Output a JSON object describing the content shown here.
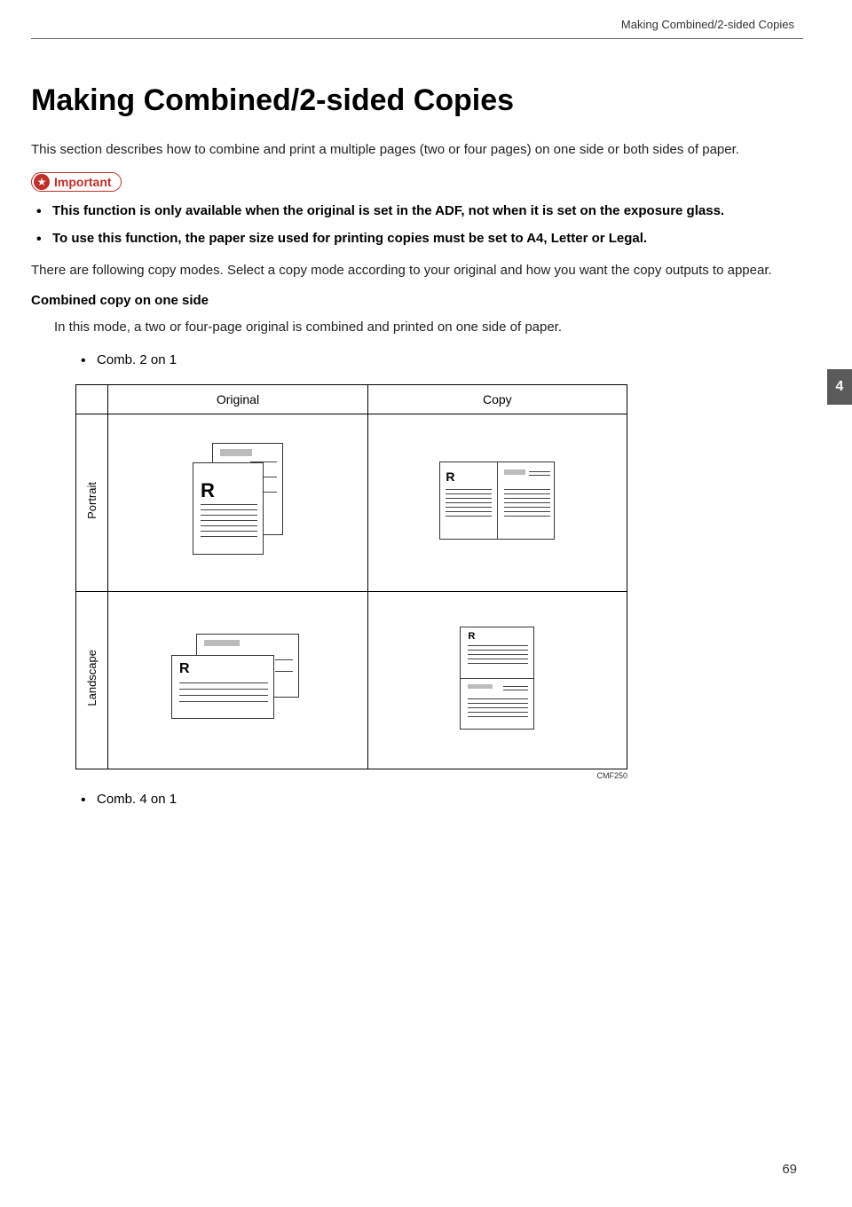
{
  "running_header": "Making Combined/2-sided Copies",
  "page_title": "Making Combined/2-sided Copies",
  "intro": "This section describes how to combine and print a multiple pages (two or four pages) on one side or both sides of paper.",
  "important_label": "Important",
  "important_bullets": [
    "This function is only available when the original is set in the ADF, not when it is set on the exposure glass.",
    "To use this function, the paper size used for printing copies must be set to A4, Letter or Legal."
  ],
  "modes_intro": "There are following copy modes. Select a copy mode according to your original and how you want the copy outputs to appear.",
  "combined_heading": "Combined copy on one side",
  "combined_desc": "In this mode, a two or four-page original is combined and printed on one side of paper.",
  "comb_bullets": [
    "Comb. 2 on 1",
    "Comb. 4 on 1"
  ],
  "table": {
    "headers": {
      "original": "Original",
      "copy": "Copy"
    },
    "rows": {
      "portrait": "Portrait",
      "landscape": "Landscape"
    },
    "figure_code": "CMF250"
  },
  "chapter_tab": "4",
  "page_number": "69",
  "glyphs": {
    "R": "R"
  }
}
